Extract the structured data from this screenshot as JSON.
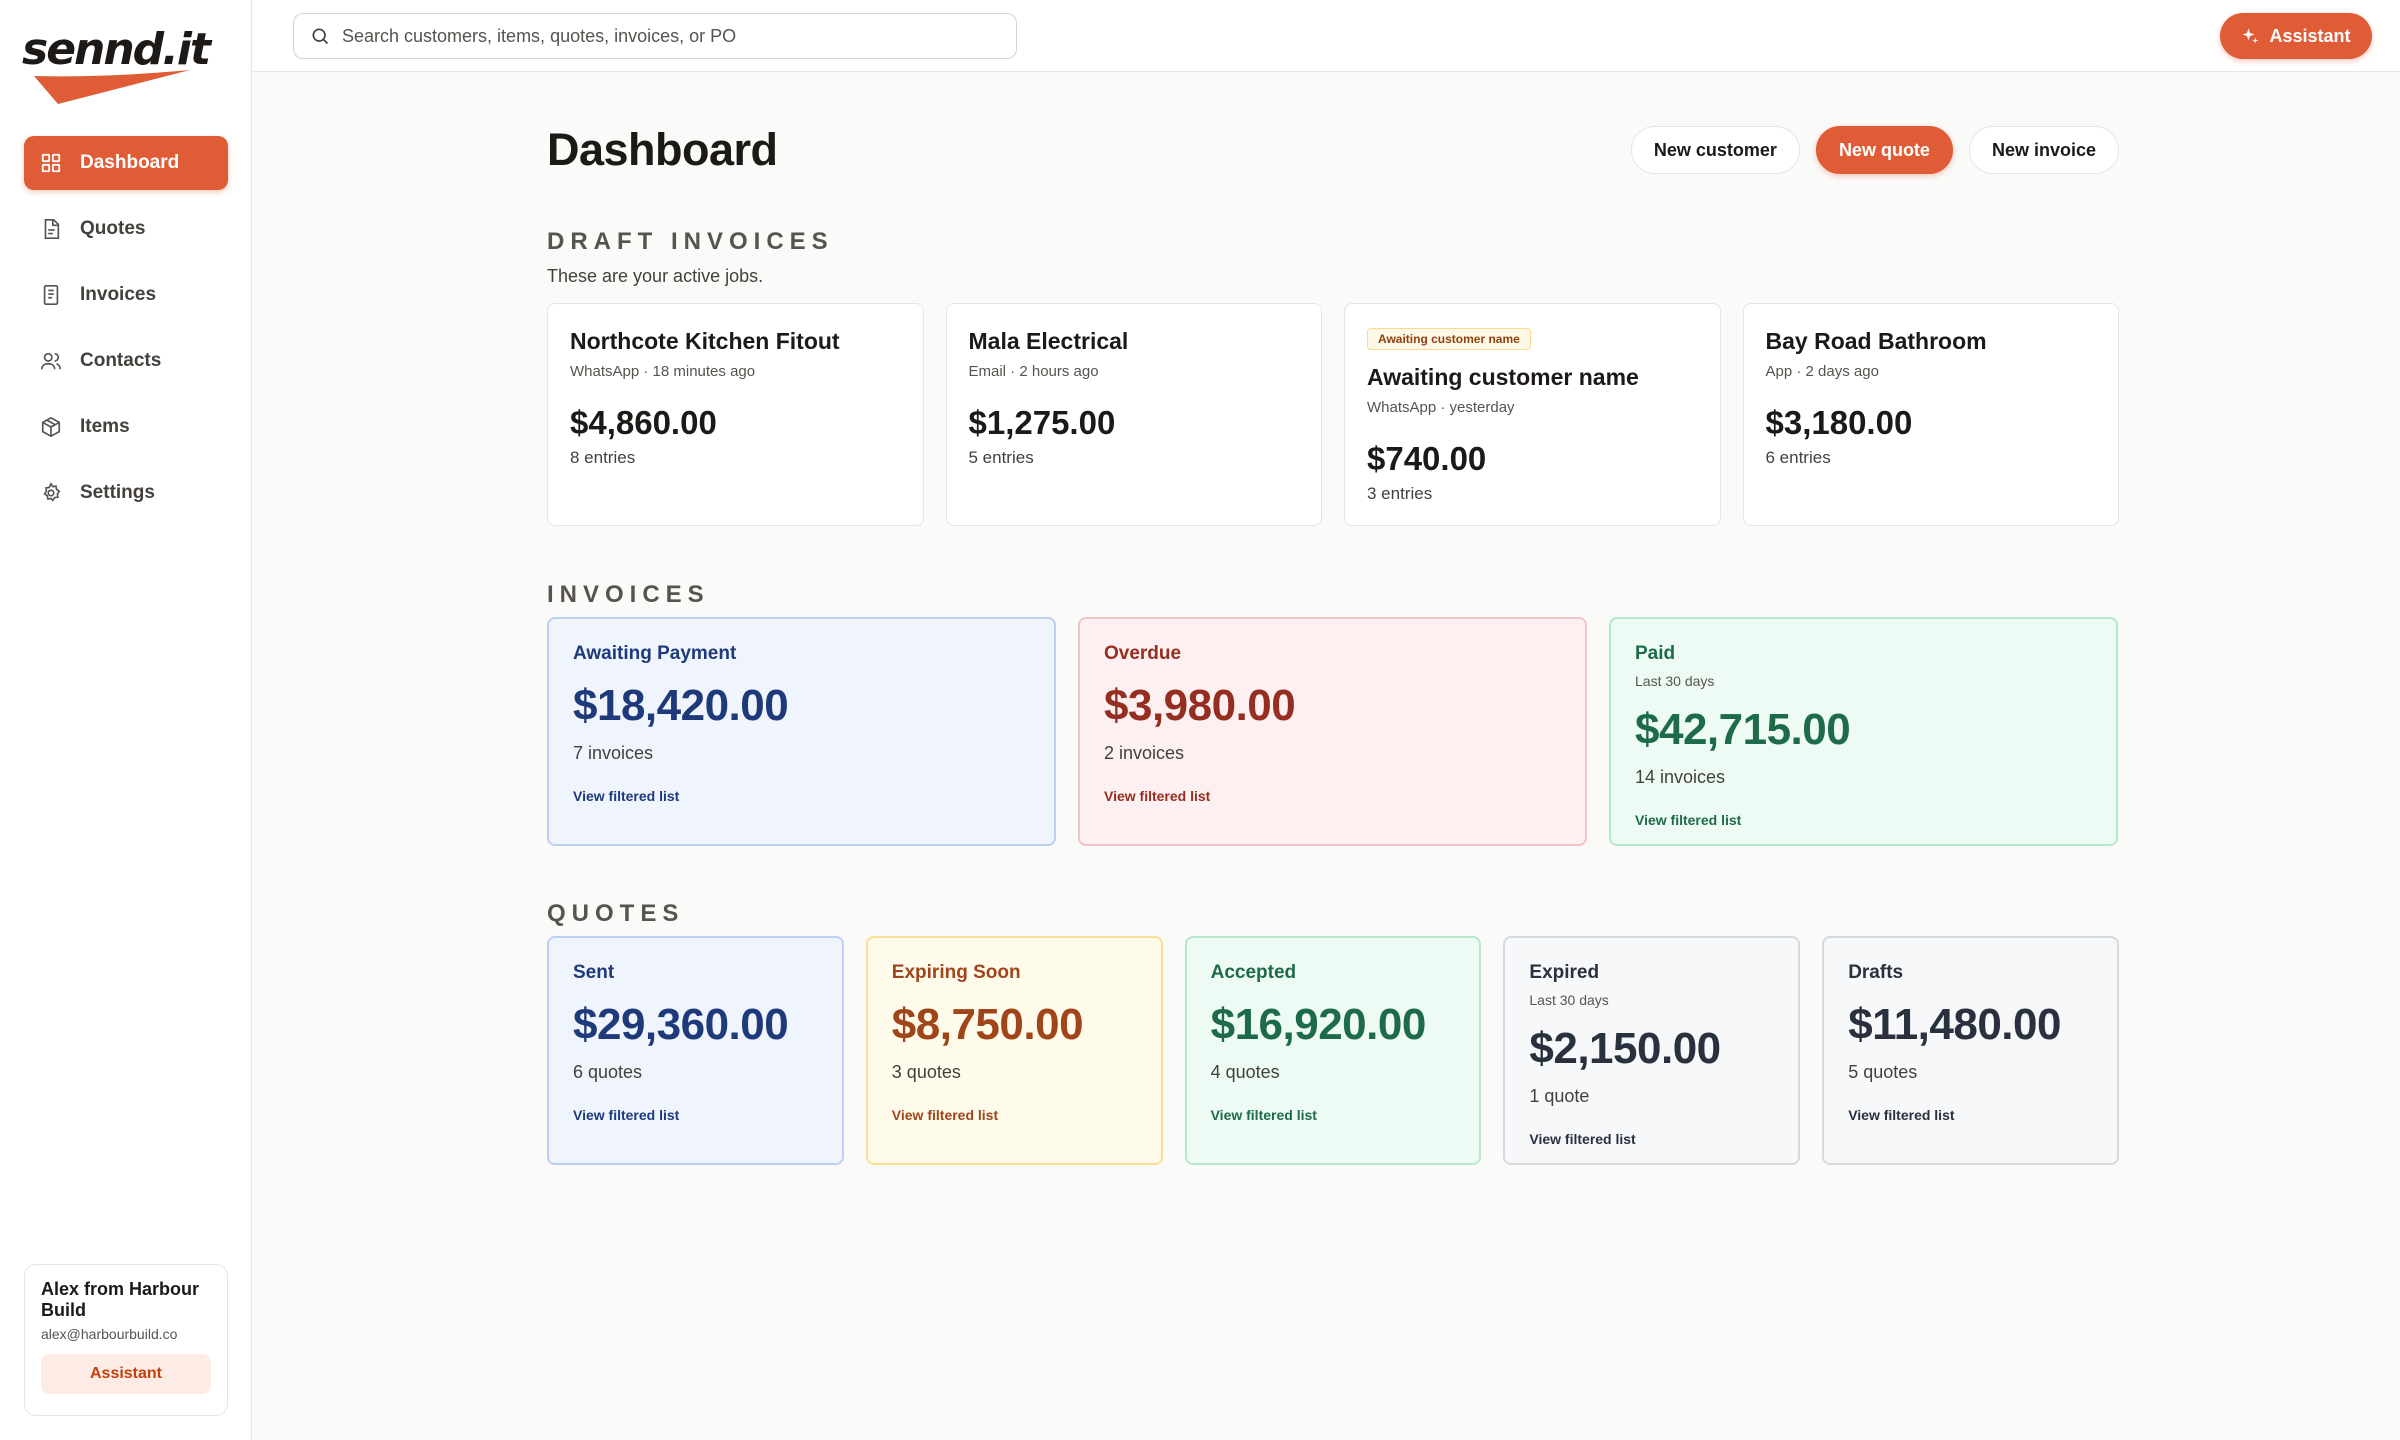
{
  "brand": {
    "logo_text": "sennd.it",
    "accent": "#e05c36"
  },
  "sidebar": {
    "items": [
      {
        "label": "Dashboard",
        "icon": "dashboard-icon",
        "active": true
      },
      {
        "label": "Quotes",
        "icon": "quote-document-icon",
        "active": false
      },
      {
        "label": "Invoices",
        "icon": "invoice-document-icon",
        "active": false
      },
      {
        "label": "Contacts",
        "icon": "contacts-icon",
        "active": false
      },
      {
        "label": "Items",
        "icon": "box-icon",
        "active": false
      },
      {
        "label": "Settings",
        "icon": "gear-icon",
        "active": false
      }
    ],
    "user": {
      "name": "Alex from Harbour Build",
      "email": "alex@harbourbuild.co",
      "assistant_label": "Assistant"
    }
  },
  "topbar": {
    "search_placeholder": "Search customers, items, quotes, invoices, or PO",
    "assistant_label": "Assistant"
  },
  "page": {
    "title": "Dashboard",
    "actions": {
      "new_customer": "New customer",
      "new_quote": "New quote",
      "new_invoice": "New invoice"
    }
  },
  "draft_invoices": {
    "heading": "DRAFT INVOICES",
    "subheading": "These are your active jobs.",
    "cards": [
      {
        "badge": "",
        "title": "Northcote Kitchen Fitout",
        "meta": "WhatsApp · 18 minutes ago",
        "amount": "$4,860.00",
        "entries": "8 entries"
      },
      {
        "badge": "",
        "title": "Mala Electrical",
        "meta": "Email · 2 hours ago",
        "amount": "$1,275.00",
        "entries": "5 entries"
      },
      {
        "badge": "Awaiting customer name",
        "title": "Awaiting customer name",
        "meta": "WhatsApp · yesterday",
        "amount": "$740.00",
        "entries": "3 entries"
      },
      {
        "badge": "",
        "title": "Bay Road Bathroom",
        "meta": "App · 2 days ago",
        "amount": "$3,180.00",
        "entries": "6 entries"
      }
    ]
  },
  "invoices": {
    "heading": "INVOICES",
    "cards": [
      {
        "label": "Awaiting Payment",
        "sub": "",
        "amount": "$18,420.00",
        "count": "7 invoices",
        "link": "View filtered list",
        "tone": "blue"
      },
      {
        "label": "Overdue",
        "sub": "",
        "amount": "$3,980.00",
        "count": "2 invoices",
        "link": "View filtered list",
        "tone": "red"
      },
      {
        "label": "Paid",
        "sub": "Last 30 days",
        "amount": "$42,715.00",
        "count": "14 invoices",
        "link": "View filtered list",
        "tone": "green"
      }
    ]
  },
  "quotes": {
    "heading": "QUOTES",
    "cards": [
      {
        "label": "Sent",
        "sub": "",
        "amount": "$29,360.00",
        "count": "6 quotes",
        "link": "View filtered list",
        "tone": "blue"
      },
      {
        "label": "Expiring Soon",
        "sub": "",
        "amount": "$8,750.00",
        "count": "3 quotes",
        "link": "View filtered list",
        "tone": "amber"
      },
      {
        "label": "Accepted",
        "sub": "",
        "amount": "$16,920.00",
        "count": "4 quotes",
        "link": "View filtered list",
        "tone": "green"
      },
      {
        "label": "Expired",
        "sub": "Last 30 days",
        "amount": "$2,150.00",
        "count": "1 quote",
        "link": "View filtered list",
        "tone": "gray"
      },
      {
        "label": "Drafts",
        "sub": "",
        "amount": "$11,480.00",
        "count": "5 quotes",
        "link": "View filtered list",
        "tone": "gray"
      }
    ]
  }
}
